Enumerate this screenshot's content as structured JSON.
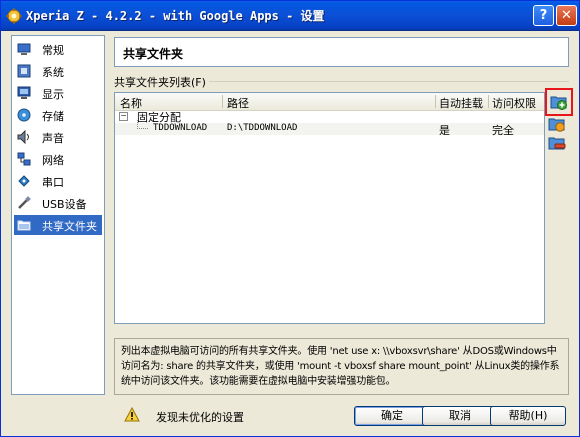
{
  "window": {
    "title": "Xperia Z - 4.2.2 - with Google Apps - 设置"
  },
  "titlebar": {
    "help_label": "?",
    "close_label": "✕"
  },
  "sidebar": {
    "items": [
      {
        "label": "常规",
        "icon": "general-icon",
        "selected": false
      },
      {
        "label": "系统",
        "icon": "system-icon",
        "selected": false
      },
      {
        "label": "显示",
        "icon": "display-icon",
        "selected": false
      },
      {
        "label": "存储",
        "icon": "storage-icon",
        "selected": false
      },
      {
        "label": "声音",
        "icon": "audio-icon",
        "selected": false
      },
      {
        "label": "网络",
        "icon": "network-icon",
        "selected": false
      },
      {
        "label": "串口",
        "icon": "serial-icon",
        "selected": false
      },
      {
        "label": "USB设备",
        "icon": "usb-icon",
        "selected": false
      },
      {
        "label": "共享文件夹",
        "icon": "shared-folder-icon",
        "selected": true
      }
    ]
  },
  "page": {
    "title": "共享文件夹",
    "list_label": "共享文件夹列表(F)"
  },
  "table": {
    "columns": [
      "名称",
      "路径",
      "自动挂载",
      "访问权限"
    ],
    "group": "固定分配",
    "group_toggle": "−",
    "rows": [
      {
        "name": "TDDOWNLOAD",
        "path": "D:\\TDDOWNLOAD",
        "automount": "是",
        "access": "完全"
      }
    ]
  },
  "description": "列出本虚拟电脑可访问的所有共享文件夹。使用 'net use x: \\\\vboxsvr\\share' 从DOS或Windows中访问名为: share 的共享文件夹，或使用 'mount -t vboxsf share mount_point' 从Linux类的操作系统中访问该文件夹。该功能需要在虚拟电脑中安装增强功能包。",
  "footer": {
    "warning": "发现未优化的设置",
    "ok": "确定",
    "cancel": "取消",
    "help": "帮助(H)"
  },
  "colors": {
    "titlebar": "#0b4fd6",
    "selection": "#316ac5",
    "highlight": "#e8151a"
  }
}
